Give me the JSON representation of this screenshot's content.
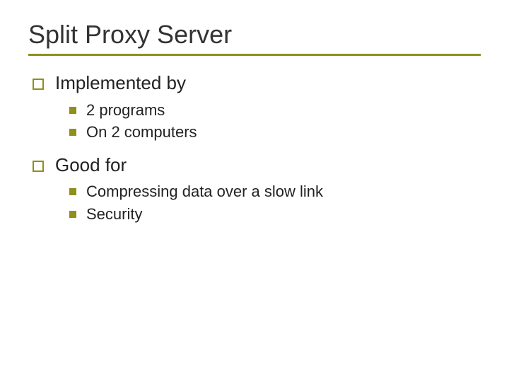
{
  "title": "Split Proxy Server",
  "sections": [
    {
      "label": "Implemented by",
      "items": [
        "2 programs",
        "On 2 computers"
      ]
    },
    {
      "label": "Good for",
      "items": [
        "Compressing data over a slow link",
        "Security"
      ]
    }
  ]
}
